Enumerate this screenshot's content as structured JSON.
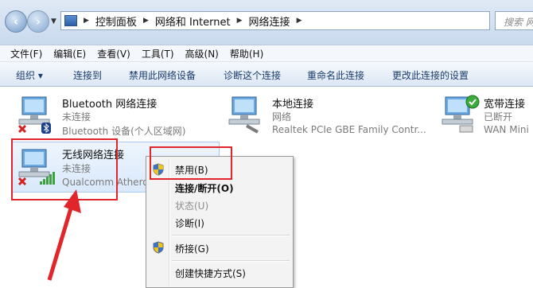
{
  "address_bar": {
    "breadcrumbs": [
      "控制面板",
      "网络和 Internet",
      "网络连接"
    ],
    "search_placeholder": "搜索 网络"
  },
  "menu_bar": {
    "items": [
      "文件(F)",
      "编辑(E)",
      "查看(V)",
      "工具(T)",
      "高级(N)",
      "帮助(H)"
    ]
  },
  "command_bar": {
    "items": [
      "组织 ▾",
      "连接到",
      "禁用此网络设备",
      "诊断这个连接",
      "重命名此连接",
      "更改此连接的设置"
    ]
  },
  "connections": [
    {
      "name": "Bluetooth 网络连接",
      "status": "未连接",
      "device": "Bluetooth 设备(个人区域网)"
    },
    {
      "name": "本地连接",
      "status": "网络",
      "device": "Realtek PCIe GBE Family Contr..."
    },
    {
      "name": "宽带连接",
      "status": "已断开",
      "device": "WAN Mini"
    },
    {
      "name": "无线网络连接",
      "status": "未连接",
      "device": "Qualcomm Athero"
    }
  ],
  "context_menu": {
    "items": [
      {
        "label": "禁用(B)",
        "style": "normal",
        "shield": true
      },
      {
        "label": "连接/断开(O)",
        "style": "bold",
        "shield": false
      },
      {
        "label": "状态(U)",
        "style": "disabled",
        "shield": false
      },
      {
        "label": "诊断(I)",
        "style": "normal",
        "shield": false
      },
      {
        "label": "桥接(G)",
        "style": "normal",
        "shield": true
      },
      {
        "label": "创建快捷方式(S)",
        "style": "normal",
        "shield": false
      }
    ]
  },
  "colors": {
    "highlight_red": "#e2252a",
    "selection_fill": "#d9e9fb",
    "command_text": "#1a3c6e"
  }
}
